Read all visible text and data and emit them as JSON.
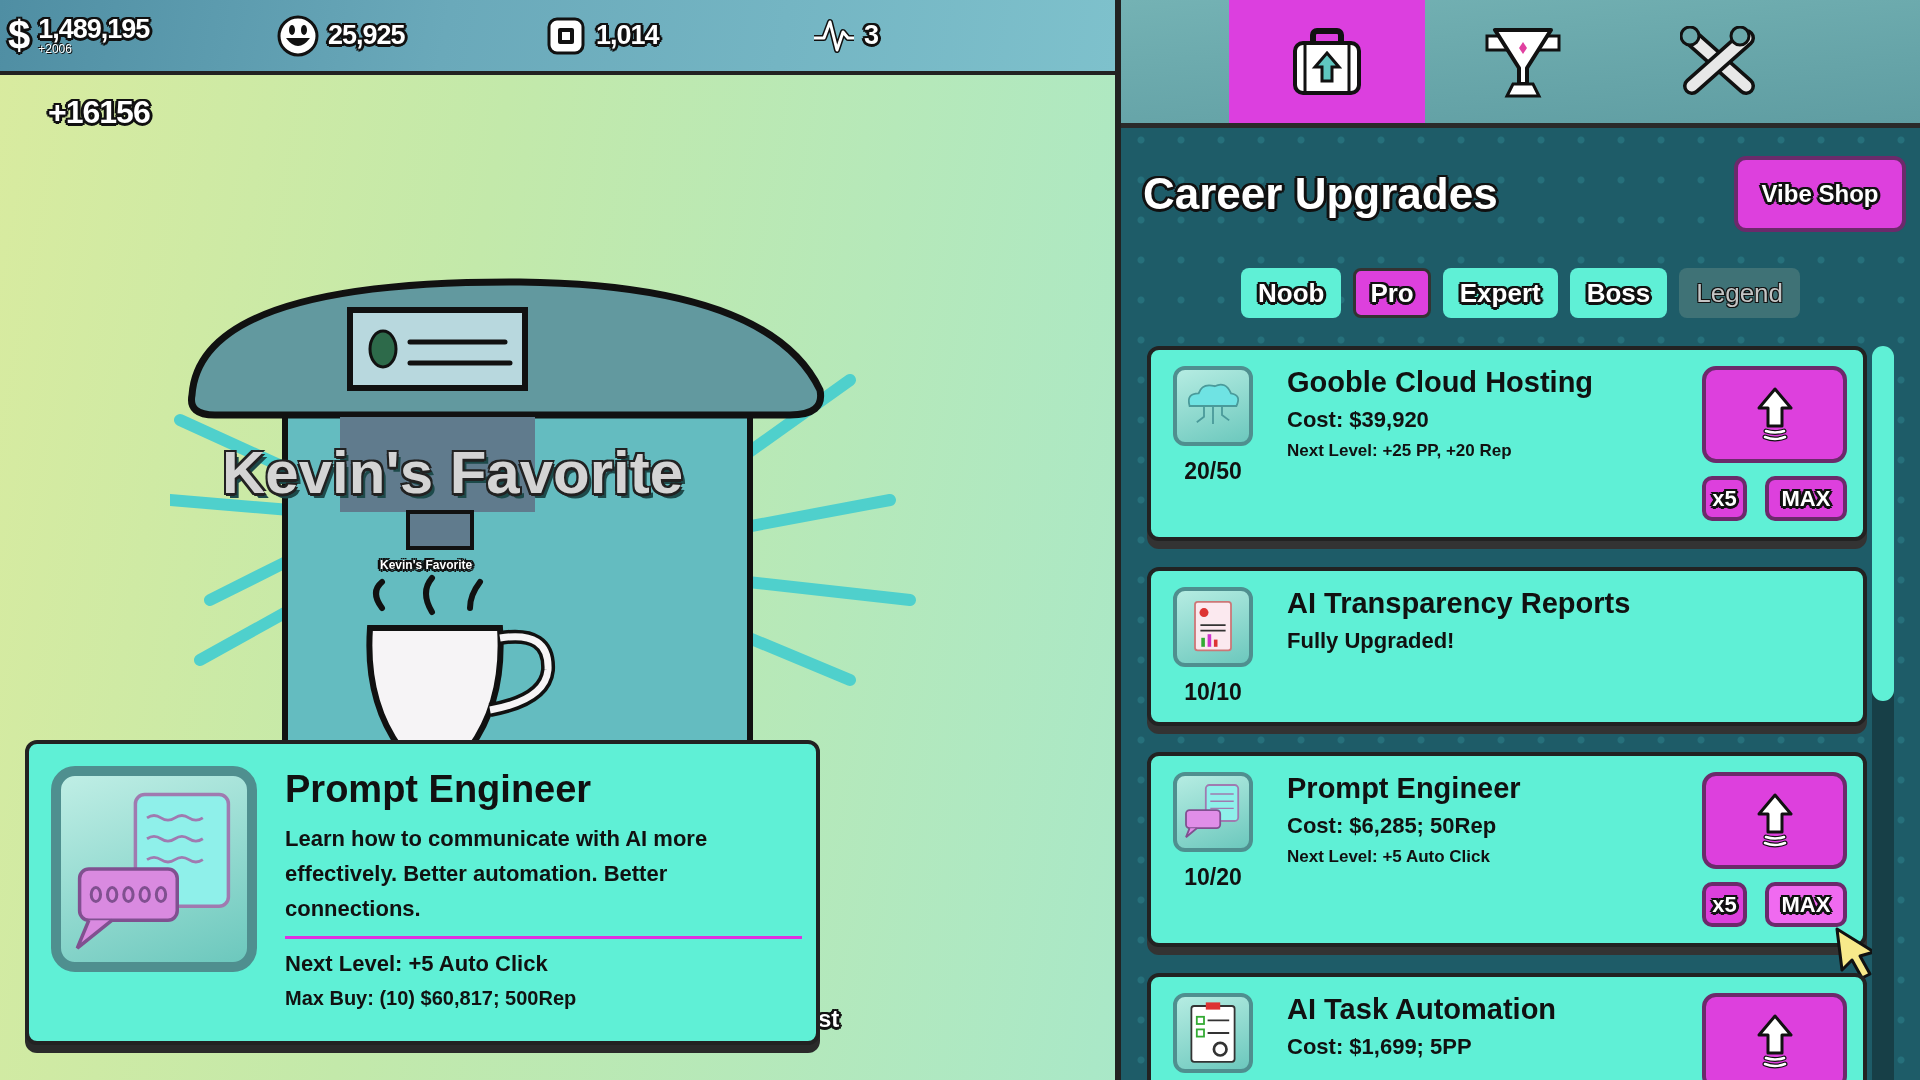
{
  "top_bar": {
    "stats": [
      {
        "kind": "money",
        "symbol": "$",
        "value": "1,489,195",
        "sub": "+2006"
      },
      {
        "kind": "smiley",
        "value": "25,925"
      },
      {
        "kind": "chip",
        "value": "1,014"
      },
      {
        "kind": "pulse",
        "value": "3"
      }
    ]
  },
  "floating_gain": "+16156",
  "scene": {
    "sign_large": "Kevin's Favorite",
    "sign_small": "Kevin's Favorite",
    "partial_text": "st"
  },
  "tooltip": {
    "title": "Prompt Engineer",
    "description": "Learn how to communicate with AI more effectively. Better automation. Better connections.",
    "next_level": "Next Level: +5 Auto Click",
    "max_buy": "Max Buy: (10) $60,817; 500Rep"
  },
  "panel_tabs": [
    {
      "selected": true
    },
    {
      "selected": false
    },
    {
      "selected": false
    }
  ],
  "panel": {
    "title": "Career Upgrades",
    "shop_button": "Vibe Shop"
  },
  "filters": [
    {
      "label": "Noob",
      "selected": false,
      "disabled": false
    },
    {
      "label": "Pro",
      "selected": true,
      "disabled": false
    },
    {
      "label": "Expert",
      "selected": false,
      "disabled": false
    },
    {
      "label": "Boss",
      "selected": false,
      "disabled": false
    },
    {
      "label": "Legend",
      "selected": false,
      "disabled": true
    }
  ],
  "upgrades": [
    {
      "kind": "upgradable",
      "title": "Gooble Cloud Hosting",
      "cost": "Cost: $39,920",
      "next_level": "Next Level: +25 PP, +20 Rep",
      "count": "20/50",
      "x5": "x5",
      "max": "MAX",
      "max_hovered": false
    },
    {
      "kind": "maxed",
      "title": "AI Transparency Reports",
      "status": "Fully Upgraded!",
      "count": "10/10"
    },
    {
      "kind": "upgradable",
      "title": "Prompt Engineer",
      "cost": "Cost: $6,285; 50Rep",
      "next_level": "Next Level: +5 Auto Click",
      "count": "10/20",
      "x5": "x5",
      "max": "MAX",
      "max_hovered": true
    },
    {
      "kind": "upgradable",
      "title": "AI Task Automation",
      "cost": "Cost: $1,699; 5PP"
    }
  ]
}
